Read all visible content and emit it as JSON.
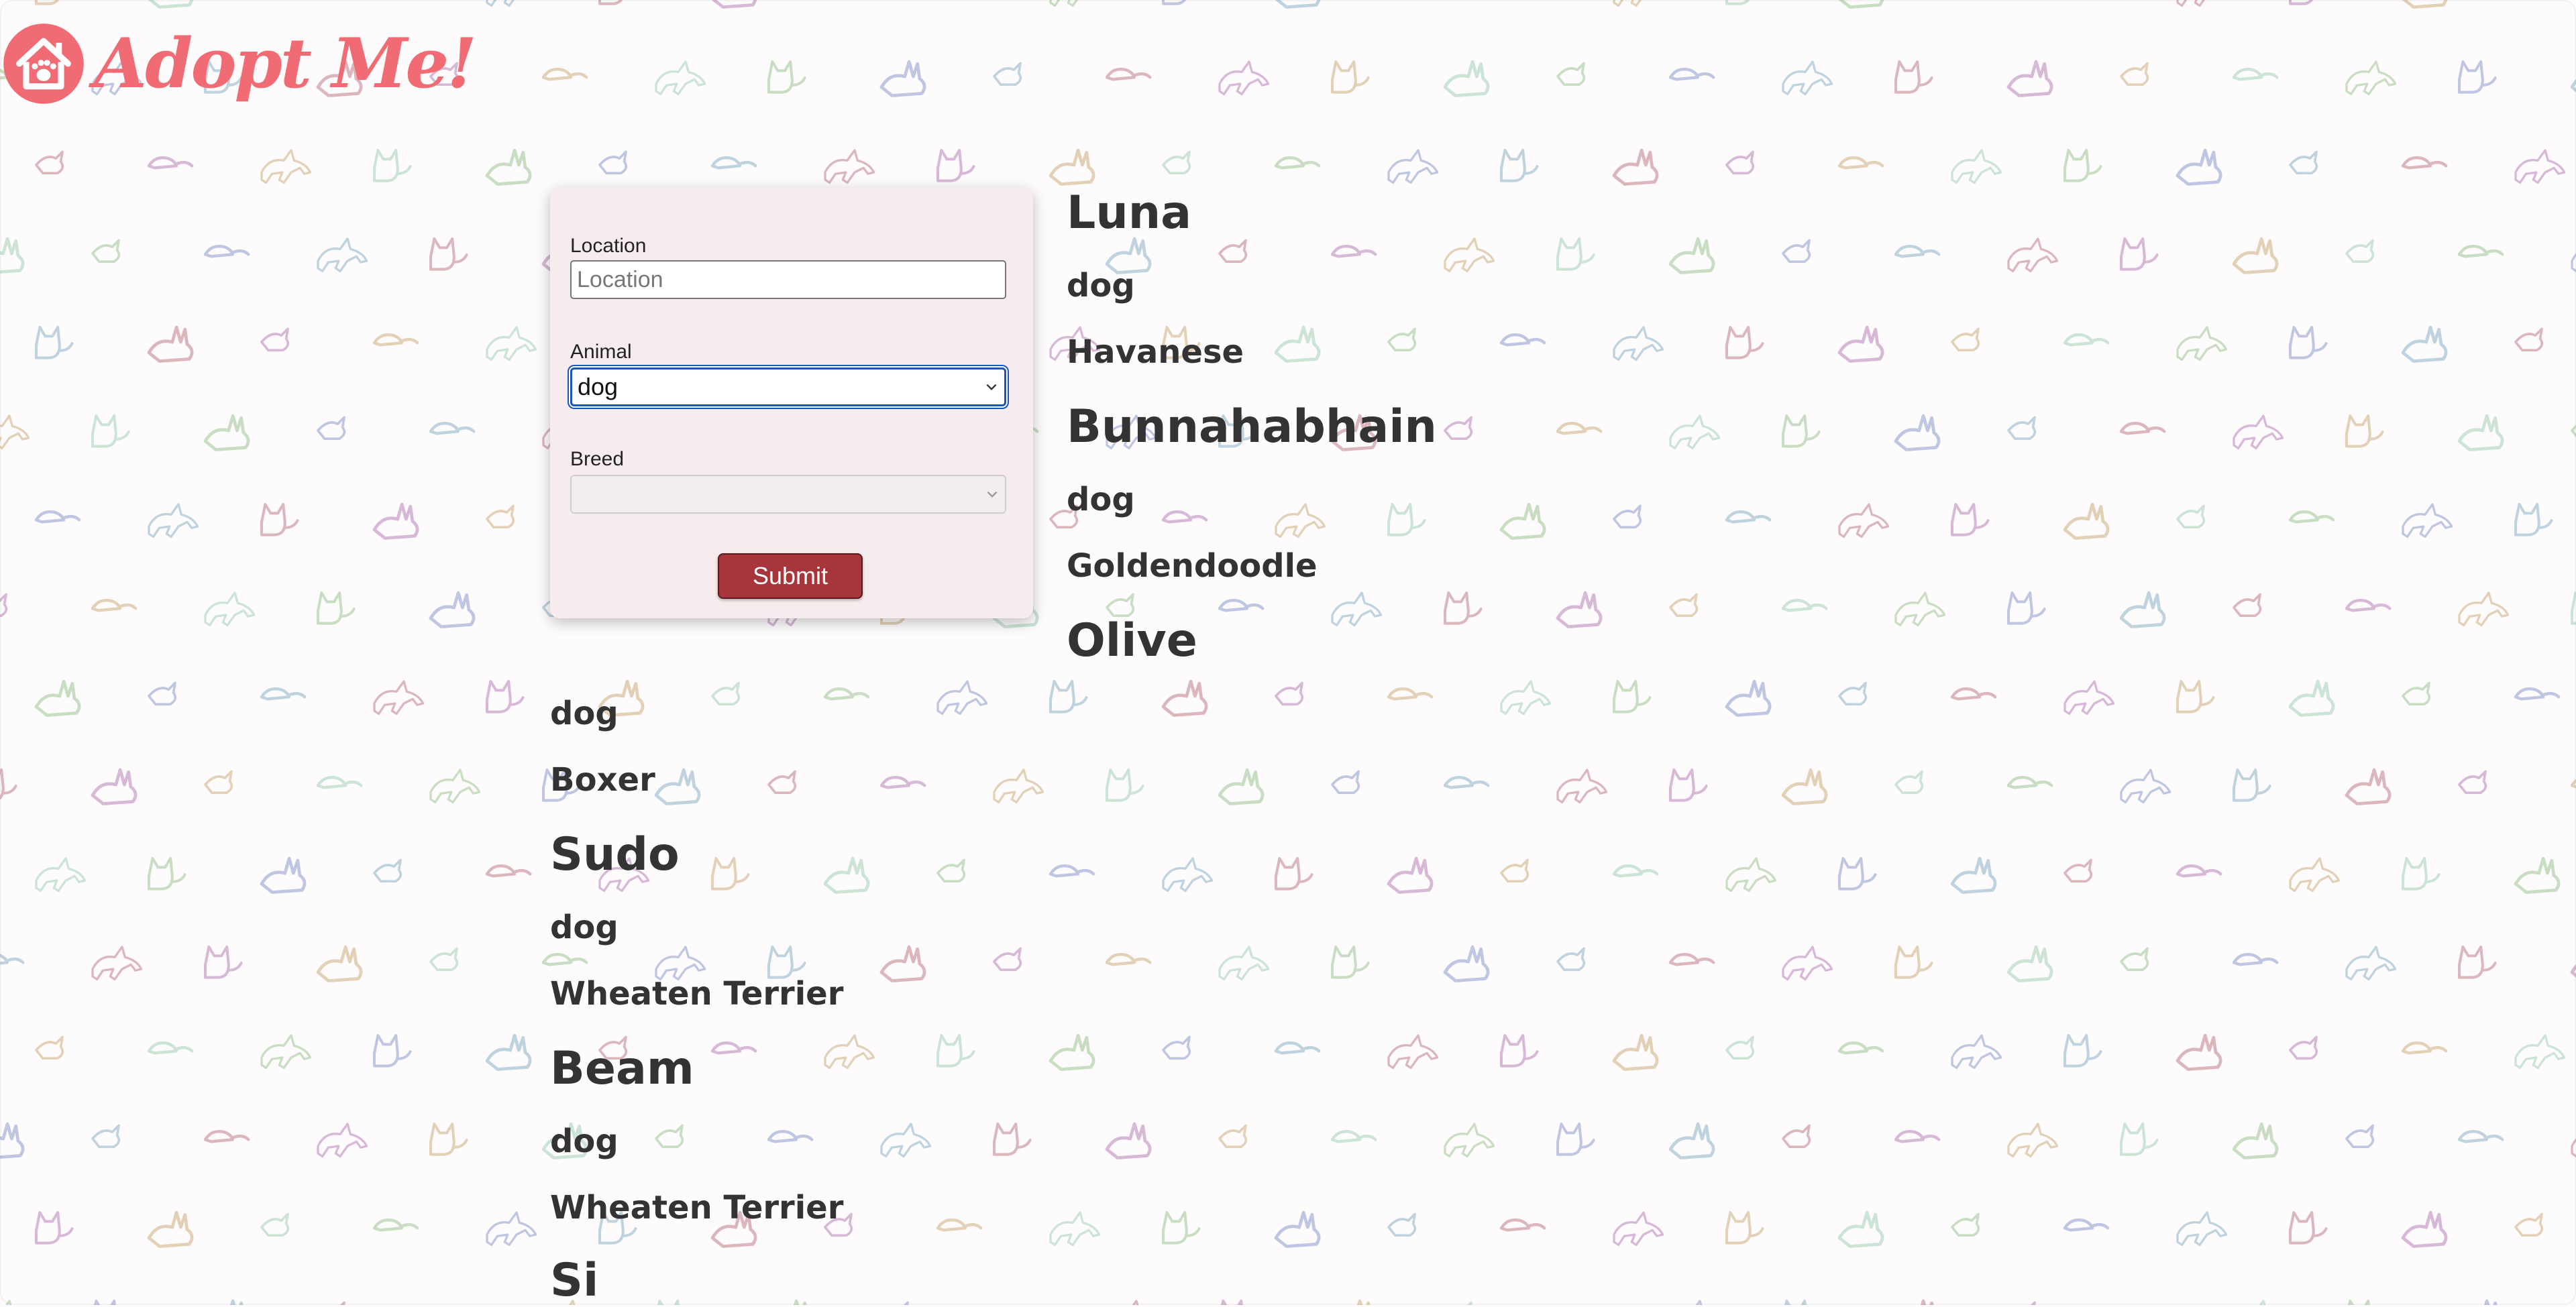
{
  "brand": {
    "name": "Adopt Me!",
    "logo_icon": "house-paw-icon",
    "color": "#f06b73"
  },
  "search_form": {
    "location": {
      "label": "Location",
      "placeholder": "Location",
      "value": ""
    },
    "animal": {
      "label": "Animal",
      "selected": "dog"
    },
    "breed": {
      "label": "Breed",
      "selected": ""
    },
    "submit_label": "Submit"
  },
  "results": [
    {
      "name": "Luna",
      "animal": "dog",
      "breed": "Havanese"
    },
    {
      "name": "Bunnahabhain",
      "animal": "dog",
      "breed": "Goldendoodle"
    },
    {
      "name": "Olive",
      "animal": "dog",
      "breed": "Boxer"
    },
    {
      "name": "Sudo",
      "animal": "dog",
      "breed": "Wheaten Terrier"
    },
    {
      "name": "Beam",
      "animal": "dog",
      "breed": "Wheaten Terrier"
    },
    {
      "name": "Si"
    }
  ],
  "colors": {
    "accent": "#a8353c",
    "card_background": "#f6eced",
    "focus_ring": "#1a56b8",
    "text": "#333333"
  }
}
